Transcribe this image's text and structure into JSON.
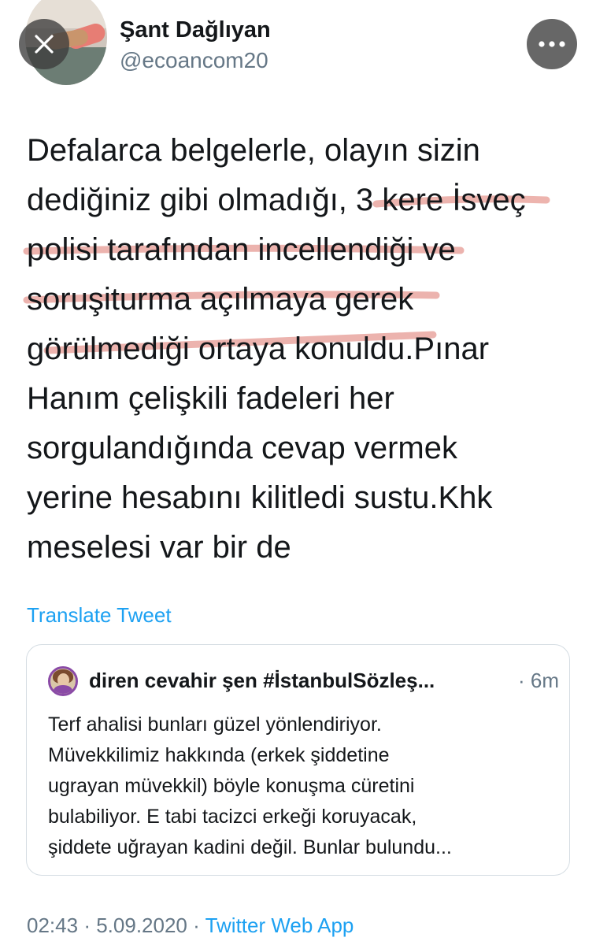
{
  "author": {
    "name": "Şant Dağlıyan",
    "handle": "@ecoancom20"
  },
  "tweet": {
    "lines": [
      "Defalarca belgelerle, olayın sizin",
      "dediğiniz gibi olmadığı, 3 kere İsveç",
      "polisi tarafından incellendiği ve",
      "soruşiturma açılmaya gerek",
      "görülmediği ortaya konuldu.Pınar",
      "Hanım çelişkili fadeleri her",
      "sorgulandığında cevap vermek",
      "yerine hesabını kilitledi sustu.Khk",
      "meselesi var bir de"
    ],
    "highlight_color": "#e8a19a"
  },
  "translate_label": "Translate Tweet",
  "quoted_tweet": {
    "author": "diren cevahir şen #İstanbulSözleş...",
    "separator": "·",
    "time": "6m",
    "lines": [
      "Terf ahalisi bunları güzel yönlendiriyor.",
      "Müvekkilimiz hakkında (erkek şiddetine",
      "ugrayan müvekkil) böyle konuşma cüretini",
      "bulabiliyor. E tabi tacizci erkeği koruyacak,",
      "şiddete uğrayan kadini değil. Bunlar bulundu..."
    ]
  },
  "footer": {
    "time": "02:43",
    "sep1": "·",
    "date": "5.09.2020",
    "sep2": "·",
    "source": "Twitter Web App"
  },
  "icons": {
    "close": "close-icon",
    "more": "more-horizontal-icon"
  },
  "colors": {
    "link": "#1da1f2",
    "secondary_text": "#657786",
    "border": "#d5dde3"
  }
}
